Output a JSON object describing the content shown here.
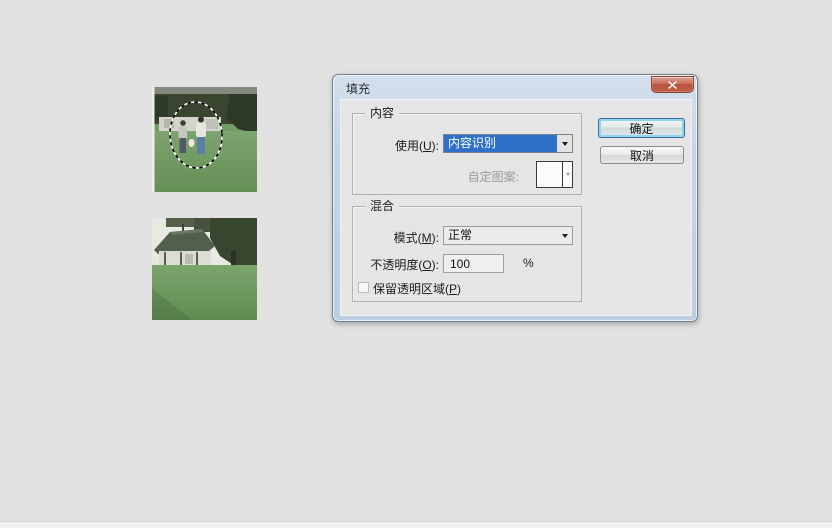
{
  "page": {
    "background_color": "#e2e2e2",
    "footer_strip_color": "#f0f0f0"
  },
  "icons": {
    "close-icon": "✕",
    "chevron-down-icon": "▼"
  },
  "photos": {
    "before": {
      "name": "park-photo-with-selection",
      "note_selection": "marching-ants-lasso"
    },
    "after": {
      "name": "park-photo-people-removed"
    }
  },
  "dialog": {
    "title": "填充",
    "content_group": {
      "legend": "内容",
      "use_label": {
        "pre": "使用(",
        "key": "U",
        "post": "):"
      },
      "use_value": "内容识别",
      "pattern_label": "自定图案:"
    },
    "blend_group": {
      "legend": "混合",
      "mode_label": {
        "pre": "模式(",
        "key": "M",
        "post": "):"
      },
      "mode_value": "正常",
      "opacity_label": {
        "pre": "不透明度(",
        "key": "O",
        "post": "):"
      },
      "opacity_value": "100",
      "opacity_unit": "%",
      "preserve_label": {
        "pre": "保留透明区域(",
        "key": "P",
        "post": ")"
      }
    },
    "buttons": {
      "ok": "确定",
      "cancel": "取消"
    },
    "colors": {
      "selection_highlight": "#2e70ca",
      "titlebar_blue": "#c6d5e6",
      "close_button_red": "#b5523e",
      "client_gray": "#e5e5e5"
    }
  }
}
